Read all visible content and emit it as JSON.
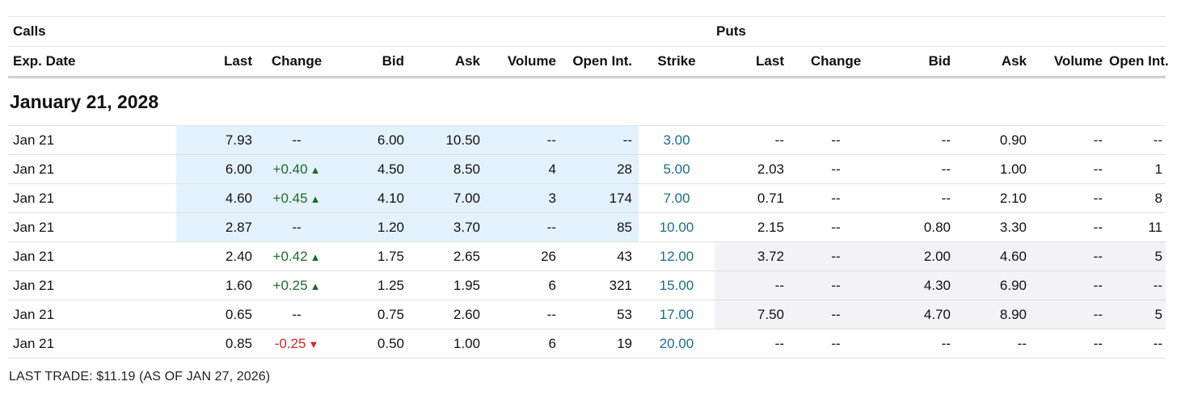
{
  "headers": {
    "calls": "Calls",
    "puts": "Puts",
    "columns": [
      "Exp. Date",
      "Last",
      "Change",
      "Bid",
      "Ask",
      "Volume",
      "Open Int.",
      "Strike",
      "Last",
      "Change",
      "Bid",
      "Ask",
      "Volume",
      "Open Int."
    ]
  },
  "group_title": "January 21, 2028",
  "rows": [
    {
      "exp": "Jan 21",
      "c_last": "7.93",
      "c_change": "--",
      "c_dir": "",
      "c_bid": "6.00",
      "c_ask": "10.50",
      "c_vol": "--",
      "c_oi": "--",
      "strike": "3.00",
      "p_last": "--",
      "p_change": "--",
      "p_bid": "--",
      "p_ask": "0.90",
      "p_vol": "--",
      "p_oi": "--",
      "call_itm": true,
      "put_itm": false
    },
    {
      "exp": "Jan 21",
      "c_last": "6.00",
      "c_change": "+0.40",
      "c_dir": "up",
      "c_bid": "4.50",
      "c_ask": "8.50",
      "c_vol": "4",
      "c_oi": "28",
      "strike": "5.00",
      "p_last": "2.03",
      "p_change": "--",
      "p_bid": "--",
      "p_ask": "1.00",
      "p_vol": "--",
      "p_oi": "1",
      "call_itm": true,
      "put_itm": false
    },
    {
      "exp": "Jan 21",
      "c_last": "4.60",
      "c_change": "+0.45",
      "c_dir": "up",
      "c_bid": "4.10",
      "c_ask": "7.00",
      "c_vol": "3",
      "c_oi": "174",
      "strike": "7.00",
      "p_last": "0.71",
      "p_change": "--",
      "p_bid": "--",
      "p_ask": "2.10",
      "p_vol": "--",
      "p_oi": "8",
      "call_itm": true,
      "put_itm": false
    },
    {
      "exp": "Jan 21",
      "c_last": "2.87",
      "c_change": "--",
      "c_dir": "",
      "c_bid": "1.20",
      "c_ask": "3.70",
      "c_vol": "--",
      "c_oi": "85",
      "strike": "10.00",
      "p_last": "2.15",
      "p_change": "--",
      "p_bid": "0.80",
      "p_ask": "3.30",
      "p_vol": "--",
      "p_oi": "11",
      "call_itm": true,
      "put_itm": false
    },
    {
      "exp": "Jan 21",
      "c_last": "2.40",
      "c_change": "+0.42",
      "c_dir": "up",
      "c_bid": "1.75",
      "c_ask": "2.65",
      "c_vol": "26",
      "c_oi": "43",
      "strike": "12.00",
      "p_last": "3.72",
      "p_change": "--",
      "p_bid": "2.00",
      "p_ask": "4.60",
      "p_vol": "--",
      "p_oi": "5",
      "call_itm": false,
      "put_itm": true
    },
    {
      "exp": "Jan 21",
      "c_last": "1.60",
      "c_change": "+0.25",
      "c_dir": "up",
      "c_bid": "1.25",
      "c_ask": "1.95",
      "c_vol": "6",
      "c_oi": "321",
      "strike": "15.00",
      "p_last": "--",
      "p_change": "--",
      "p_bid": "4.30",
      "p_ask": "6.90",
      "p_vol": "--",
      "p_oi": "--",
      "call_itm": false,
      "put_itm": true
    },
    {
      "exp": "Jan 21",
      "c_last": "0.65",
      "c_change": "--",
      "c_dir": "",
      "c_bid": "0.75",
      "c_ask": "2.60",
      "c_vol": "--",
      "c_oi": "53",
      "strike": "17.00",
      "p_last": "7.50",
      "p_change": "--",
      "p_bid": "4.70",
      "p_ask": "8.90",
      "p_vol": "--",
      "p_oi": "5",
      "call_itm": false,
      "put_itm": true
    },
    {
      "exp": "Jan 21",
      "c_last": "0.85",
      "c_change": "-0.25",
      "c_dir": "down",
      "c_bid": "0.50",
      "c_ask": "1.00",
      "c_vol": "6",
      "c_oi": "19",
      "strike": "20.00",
      "p_last": "--",
      "p_change": "--",
      "p_bid": "--",
      "p_ask": "--",
      "p_vol": "--",
      "p_oi": "--",
      "call_itm": false,
      "put_itm": false
    }
  ],
  "footer": "LAST TRADE: $11.19 (AS OF JAN 27, 2026)",
  "colors": {
    "call_itm_bg": "#e3f1fd",
    "put_itm_bg": "#f3f3f7",
    "strike": "#1a6e8c",
    "positive": "#1d6b2b",
    "negative": "#d0262f"
  },
  "icons": {
    "up": "triangle-up-icon",
    "down": "triangle-down-icon"
  }
}
